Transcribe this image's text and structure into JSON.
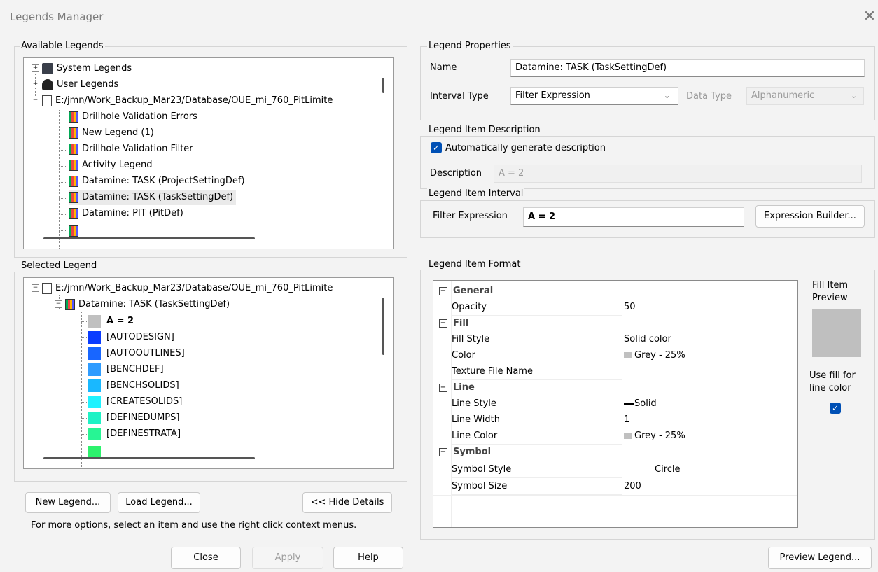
{
  "window": {
    "title": "Legends Manager"
  },
  "available": {
    "label": "Available Legends",
    "items": [
      {
        "text": "System Legends"
      },
      {
        "text": "User Legends"
      },
      {
        "text": "E:/jmn/Work_Backup_Mar23/Database/OUE_mi_760_PitLimite"
      },
      {
        "text": "Drillhole Validation Errors"
      },
      {
        "text": "New Legend (1)"
      },
      {
        "text": "Drillhole Validation Filter"
      },
      {
        "text": "Activity Legend"
      },
      {
        "text": "Datamine: TASK (ProjectSettingDef)"
      },
      {
        "text": "Datamine: TASK (TaskSettingDef)"
      },
      {
        "text": "Datamine: PIT (PitDef)"
      }
    ]
  },
  "selected": {
    "label": "Selected Legend",
    "root": "E:/jmn/Work_Backup_Mar23/Database/OUE_mi_760_PitLimite",
    "legend": "Datamine: TASK (TaskSettingDef)",
    "items": [
      {
        "text": "A = 2",
        "color": "#c0c0c0"
      },
      {
        "text": "[AUTODESIGN]",
        "color": "#0a3cff"
      },
      {
        "text": "[AUTOOUTLINES]",
        "color": "#1866ff"
      },
      {
        "text": "[BENCHDEF]",
        "color": "#2f9cff"
      },
      {
        "text": "[BENCHSOLIDS]",
        "color": "#19b8ff"
      },
      {
        "text": "[CREATESOLIDS]",
        "color": "#1ff2ff"
      },
      {
        "text": "[DEFINEDUMPS]",
        "color": "#1ef2c5"
      },
      {
        "text": "[DEFINESTRATA]",
        "color": "#27f594"
      }
    ]
  },
  "buttons": {
    "new_legend": "New Legend...",
    "load_legend": "Load Legend...",
    "hide_details": "<< Hide Details",
    "close": "Close",
    "apply": "Apply",
    "help": "Help",
    "expression_builder": "Expression Builder...",
    "preview_legend": "Preview Legend..."
  },
  "hint": "For more options, select an item and use the right click context menus.",
  "properties": {
    "label": "Legend Properties",
    "name_label": "Name",
    "name_value": "Datamine: TASK (TaskSettingDef)",
    "interval_label": "Interval Type",
    "interval_value": "Filter Expression",
    "datatype_label": "Data Type",
    "datatype_value": "Alphanumeric"
  },
  "description": {
    "label": "Legend Item Description",
    "auto_label": "Automatically generate description",
    "auto_checked": true,
    "desc_label": "Description",
    "desc_value": "A = 2"
  },
  "interval": {
    "label": "Legend Item Interval",
    "filter_label": "Filter Expression",
    "filter_value": "A = 2"
  },
  "format": {
    "label": "Legend Item Format",
    "general": "General",
    "opacity_label": "Opacity",
    "opacity_value": "50",
    "fill": "Fill",
    "fill_style_label": "Fill Style",
    "fill_style_value": "Solid color",
    "color_label": "Color",
    "color_value": "Grey - 25%",
    "texture_label": "Texture File Name",
    "line": "Line",
    "line_style_label": "Line Style",
    "line_style_value": "Solid",
    "line_width_label": "Line Width",
    "line_width_value": "1",
    "line_color_label": "Line Color",
    "line_color_value": "Grey - 25%",
    "symbol": "Symbol",
    "symbol_style_label": "Symbol Style",
    "symbol_style_value": "Circle",
    "symbol_size_label": "Symbol Size",
    "symbol_size_value": "200",
    "preview_label_1": "Fill Item",
    "preview_label_2": "Preview",
    "use_fill_1": "Use fill for",
    "use_fill_2": "line color",
    "use_fill_checked": true,
    "preview_color": "#bfbfbf"
  }
}
